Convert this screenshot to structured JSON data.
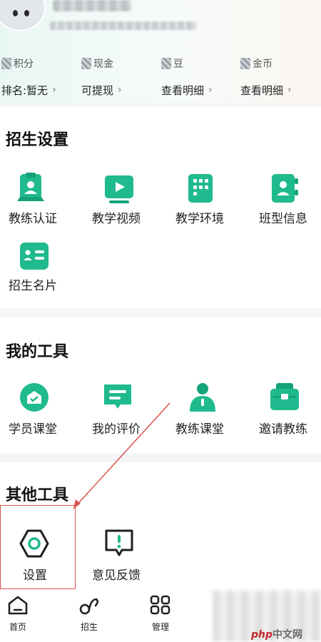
{
  "header": {
    "stats": [
      {
        "label": "积分",
        "value": "排名:暂无"
      },
      {
        "label": "现金",
        "value": "可提现"
      },
      {
        "label": "豆",
        "value": "查看明细"
      },
      {
        "label": "金币",
        "value": "查看明细"
      }
    ]
  },
  "sections": {
    "enroll": {
      "title": "招生设置",
      "items": [
        "教练认证",
        "教学视频",
        "教学环境",
        "班型信息",
        "招生名片"
      ]
    },
    "tools": {
      "title": "我的工具",
      "items": [
        "学员课堂",
        "我的评价",
        "教练课堂",
        "邀请教练"
      ]
    },
    "other": {
      "title": "其他工具",
      "items": [
        "设置",
        "意见反馈"
      ]
    }
  },
  "nav": {
    "items": [
      "首页",
      "招生",
      "管理"
    ]
  },
  "watermark": {
    "brand": "php",
    "text": "中文网"
  },
  "colors": {
    "accent": "#1fba8d",
    "accent_dark": "#14a37a",
    "highlight": "#d9534f"
  }
}
